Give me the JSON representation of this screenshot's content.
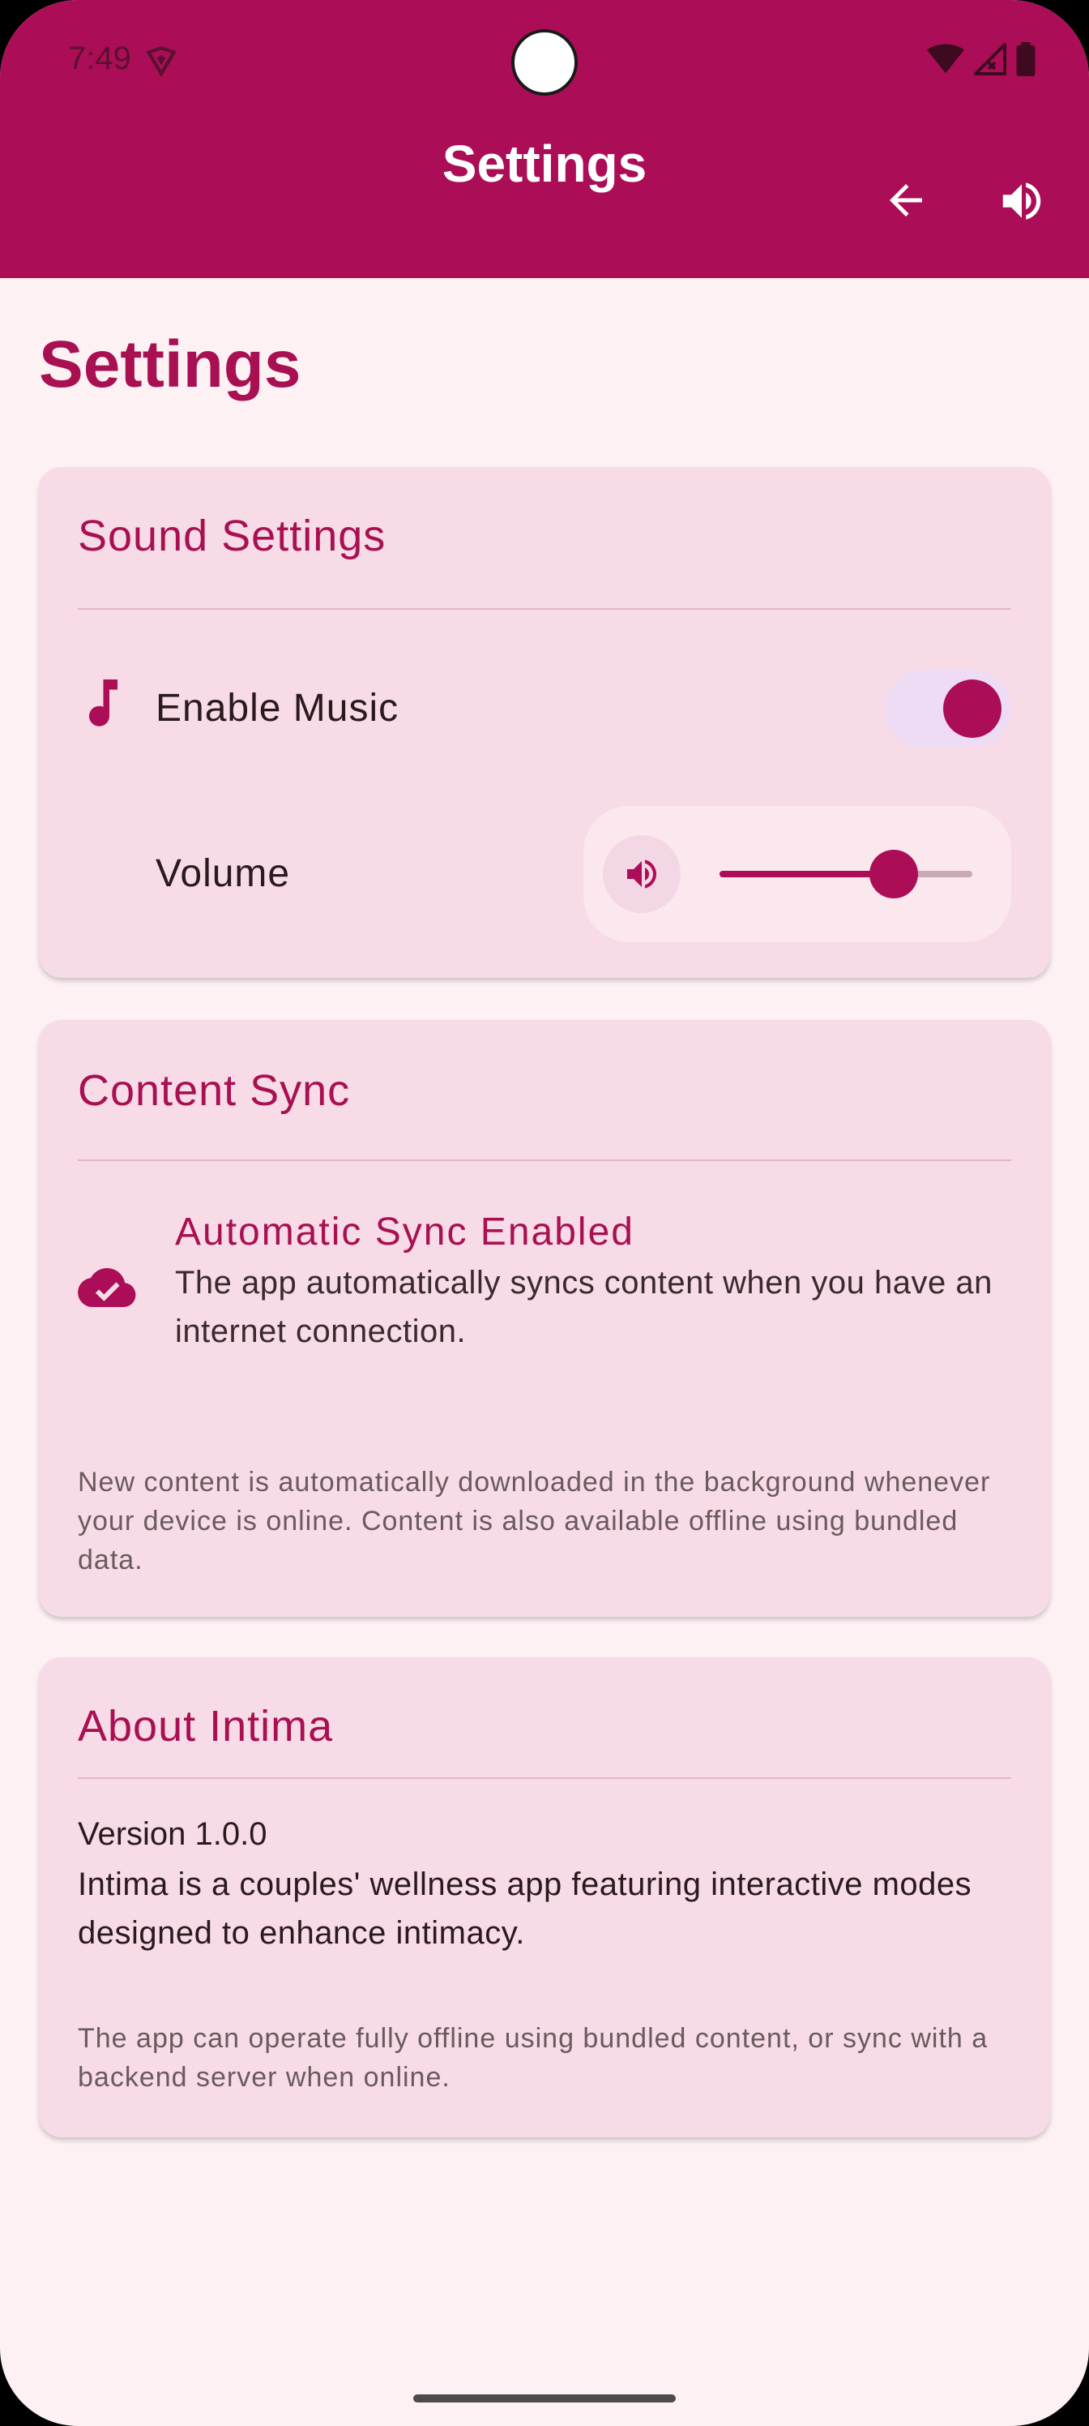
{
  "status_bar": {
    "time": "7:49"
  },
  "app_bar": {
    "title": "Settings",
    "back_icon": "arrow-left-icon",
    "sound_icon": "volume-up-icon"
  },
  "page": {
    "title": "Settings"
  },
  "sound_settings": {
    "title": "Sound Settings",
    "enable_music_label": "Enable Music",
    "enable_music_on": true,
    "volume_label": "Volume",
    "volume_level": 0.69
  },
  "content_sync": {
    "title": "Content Sync",
    "status_title": "Automatic Sync Enabled",
    "status_description": "The app automatically syncs content when you have an internet connection.",
    "note": "New content is automatically downloaded in the background whenever your device is online. Content is also available offline using bundled data."
  },
  "about": {
    "title": "About Intima",
    "version": "Version 1.0.0",
    "description": "Intima is a couples' wellness app featuring interactive modes designed to enhance intimacy.",
    "note": "The app can operate fully offline using bundled content, or sync with a backend server when online."
  },
  "colors": {
    "primary": "#ab0e56",
    "background": "#fdf1f4",
    "card": "#f7dbe6"
  }
}
